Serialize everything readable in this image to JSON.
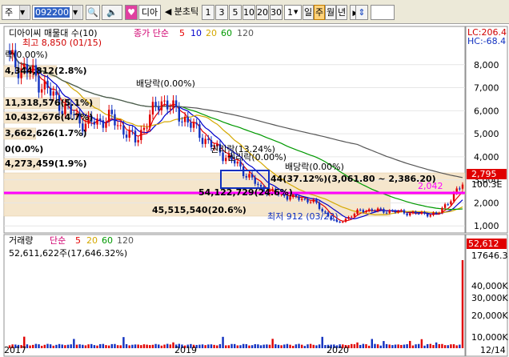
{
  "toolbar": {
    "market_label": "주",
    "stock_code": "092200",
    "stock_name_short": "디아",
    "period_prefix": "◀ 분초틱",
    "period_buttons": [
      "1",
      "3",
      "5",
      "10",
      "20",
      "30"
    ],
    "count_value": "1",
    "timeframes": [
      "일",
      "주",
      "월",
      "년"
    ],
    "selected_timeframe": "주"
  },
  "upper_panel": {
    "legend_title": "디아이씨 매물대 수(10)",
    "legend_ma_label": "종가 단순",
    "ma_periods": [
      "5",
      "10",
      "20",
      "60",
      "120"
    ],
    "ma_colors": [
      "#e60000",
      "#0000cc",
      "#d4a800",
      "#009900",
      "#555555"
    ],
    "lc_label": "LC:206.4",
    "hc_label": "HC:-68.4",
    "y_ticks": [
      "8,000",
      "7,000",
      "6,000",
      "5,000",
      "4,000",
      "3,000",
      "2,000",
      "1,000"
    ],
    "price_tags": [
      "2,795",
      "100.3E"
    ],
    "pink_line_label": "2,042",
    "annotations": {
      "high": "최고 8,850 (01/15)",
      "low": "최저 912 (03/23)",
      "dividend_1": "배당락(0.00%)",
      "dividend_2": "배당락(0.00%)",
      "rights_1": "권리락(13.24%)",
      "rights_2": "권리락(0.00%)",
      "rights_3": "락(0.00%)",
      "range_note": "44(37.12%)(3,061.80 ~ 2,386.20)"
    },
    "volume_profile": [
      {
        "label": "4,344,812(2.8%)",
        "value": 4344812,
        "pct": 2.8
      },
      {
        "label": "11,318,576(5.1%)",
        "value": 11318576,
        "pct": 5.1
      },
      {
        "label": "10,432,676(4.7%)",
        "value": 10432676,
        "pct": 4.7
      },
      {
        "label": "3,662,626(1.7%)",
        "value": 3662626,
        "pct": 1.7
      },
      {
        "label": "0(0.0%)",
        "value": 0,
        "pct": 0.0
      },
      {
        "label": "4,273,459(1.9%)",
        "value": 4273459,
        "pct": 1.9
      },
      {
        "label": "54,122,729(24.6%)",
        "value": 54122729,
        "pct": 24.6
      },
      {
        "label": "45,515,540(20.6%)",
        "value": 45515540,
        "pct": 20.6
      }
    ]
  },
  "lower_panel": {
    "legend_title": "거래량",
    "legend_ma_label": "단순",
    "ma_periods": [
      "5",
      "20",
      "60",
      "120"
    ],
    "summary": "52,611,622주(17,646.32%)",
    "y_ticks": [
      "40,000K",
      "30,000K",
      "20,000K",
      "10,000K"
    ],
    "value_tags": [
      "52,612",
      "17646.3"
    ]
  },
  "x_axis": {
    "labels": [
      "2017",
      "2019",
      "2020",
      "12/14"
    ]
  },
  "chart_data": {
    "type": "candlestick",
    "title": "디아이씨 매물대 수(10)",
    "frequency": "weekly",
    "ylim": [
      800,
      9000
    ],
    "x_range": [
      "2017-12",
      "2020-12-14"
    ],
    "price_series": {
      "name": "종가",
      "x": [
        "2018-01",
        "2018-03",
        "2018-05",
        "2018-07",
        "2018-09",
        "2018-11",
        "2019-01",
        "2019-03",
        "2019-05",
        "2019-07",
        "2019-09",
        "2019-11",
        "2020-01",
        "2020-03",
        "2020-05",
        "2020-07",
        "2020-09",
        "2020-11",
        "2020-12"
      ],
      "values": [
        8200,
        7500,
        6300,
        5400,
        5700,
        4700,
        6500,
        5600,
        4500,
        3700,
        2600,
        2300,
        2100,
        1100,
        1700,
        1650,
        1550,
        1500,
        2795
      ]
    },
    "volume_series": {
      "name": "거래량",
      "last_value": 52611622,
      "ylim": [
        0,
        55000000
      ]
    }
  }
}
